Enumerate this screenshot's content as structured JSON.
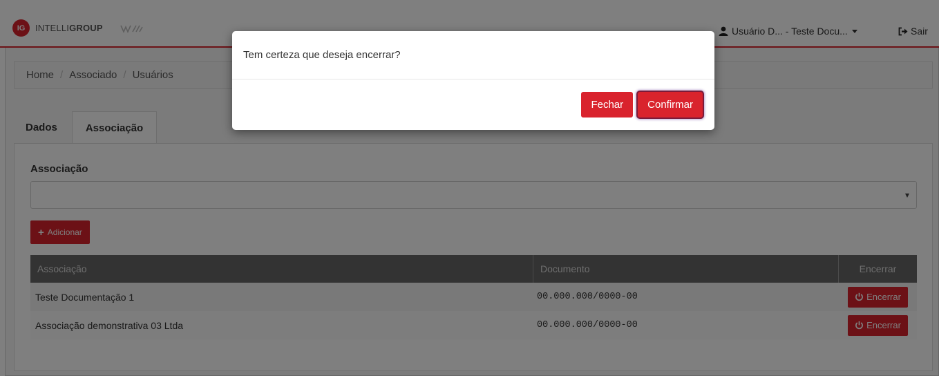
{
  "brand": {
    "badge": "IG",
    "name_light": "INTELLI",
    "name_bold": "GROUP"
  },
  "header": {
    "user_label": "Usuário D... - Teste Docu...",
    "logout_label": "Sair"
  },
  "breadcrumb": [
    "Home",
    "Associado",
    "Usuários"
  ],
  "tabs": [
    {
      "label": "Dados"
    },
    {
      "label": "Associação"
    }
  ],
  "form": {
    "field_label": "Associação",
    "select_value": "",
    "add_button": "Adicionar"
  },
  "table": {
    "headers": [
      "Associação",
      "Documento",
      "Encerrar"
    ],
    "rows": [
      {
        "associacao": "Teste Documentação 1",
        "documento": "00.000.000/0000-00",
        "action": "Encerrar"
      },
      {
        "associacao": "Associação demonstrativa 03 Ltda",
        "documento": "00.000.000/0000-00",
        "action": "Encerrar"
      }
    ]
  },
  "modal": {
    "message": "Tem certeza que deseja encerrar?",
    "close_button": "Fechar",
    "confirm_button": "Confirmar"
  },
  "colors": {
    "accent": "#d9232d",
    "table_header": "#666666",
    "backdrop": "rgba(0,0,0,0.5)"
  },
  "icons": [
    "user-icon",
    "logout-icon",
    "plus-icon",
    "power-icon",
    "chevron-down-icon"
  ]
}
